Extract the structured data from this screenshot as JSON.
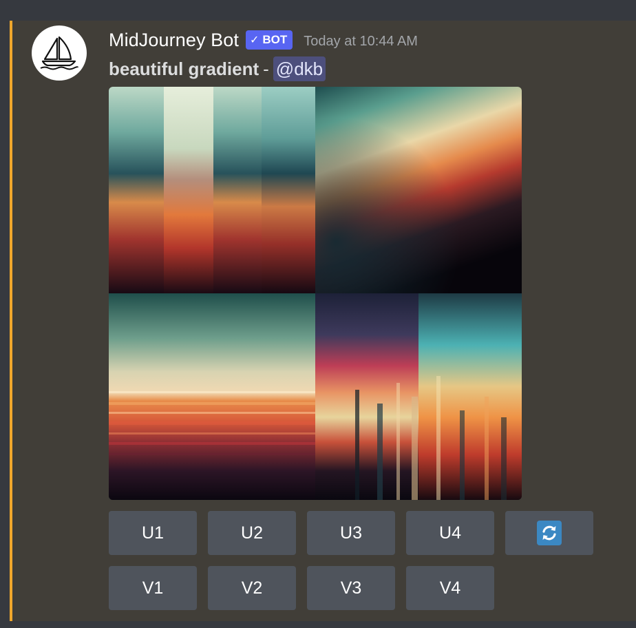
{
  "message": {
    "author": "MidJourney Bot",
    "badge": "BOT",
    "badge_check": "✓",
    "timestamp": "Today at 10:44 AM",
    "prompt": "beautiful gradient",
    "separator": "-",
    "mention": "@dkb",
    "accent_color": "#f0a72c",
    "avatar_icon": "sailboat-logo-icon"
  },
  "image_grid": {
    "tiles": [
      "vertical-band-gradient",
      "diagonal-soft-gradient",
      "horizontal-stripe-gradient",
      "vertical-streak-gradient"
    ]
  },
  "buttons": {
    "upscale": [
      "U1",
      "U2",
      "U3",
      "U4"
    ],
    "variation": [
      "V1",
      "V2",
      "V3",
      "V4"
    ],
    "reroll_icon": "refresh-icon"
  }
}
